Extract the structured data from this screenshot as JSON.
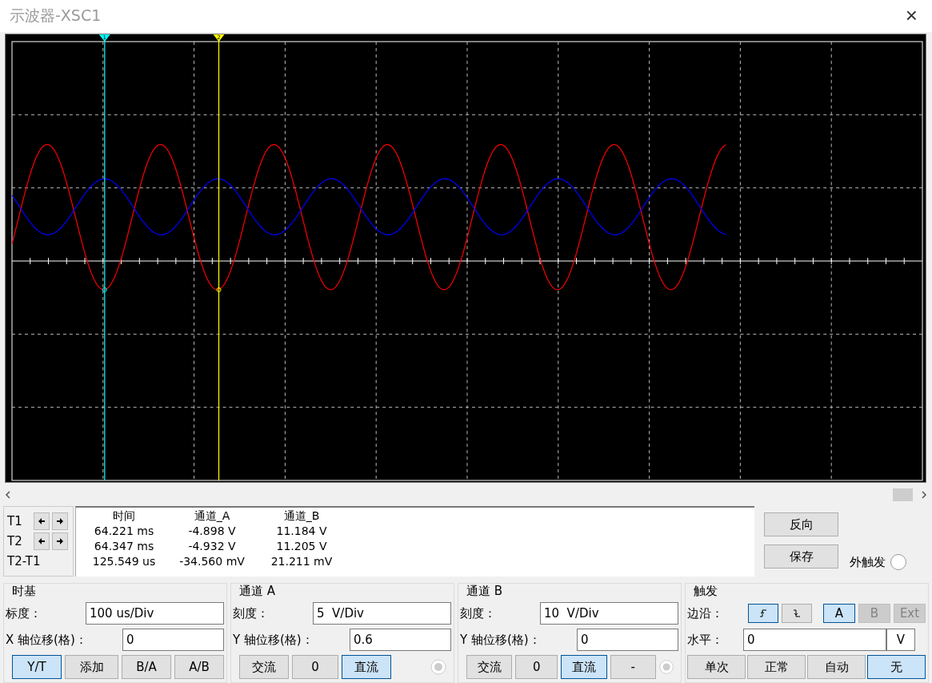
{
  "window": {
    "title": "示波器-XSC1",
    "close": "×"
  },
  "display": {
    "cursors": [
      {
        "label": "1",
        "color": "#00ffff"
      },
      {
        "label": "2",
        "color": "#ffff00"
      }
    ]
  },
  "cursor_controls": [
    {
      "label": "T1",
      "kind": "cursor"
    },
    {
      "label": "T2",
      "kind": "cursor"
    },
    {
      "label": "T2-T1",
      "kind": "difference"
    }
  ],
  "readout": {
    "columns": [
      "时间",
      "通道_A",
      "通道_B"
    ],
    "rows": [
      [
        "64.221 ms",
        "-4.898 V",
        "11.184 V"
      ],
      [
        "64.347 ms",
        "-4.932 V",
        "11.205 V"
      ],
      [
        "125.549 us",
        "-34.560 mV",
        "21.211 mV"
      ]
    ]
  },
  "buttons": [
    "反向",
    "保存"
  ],
  "external_trigger": {
    "label": "外触发",
    "selected": false
  },
  "timebase": {
    "title": "时基",
    "fields": [
      {
        "label": "标度：",
        "value": "100 us/Div"
      },
      {
        "label": "X 轴位移(格)：",
        "value": "0"
      }
    ],
    "modes": [
      {
        "label": "Y/T",
        "selected": true
      },
      {
        "label": "添加",
        "selected": false
      },
      {
        "label": "B/A",
        "selected": false
      },
      {
        "label": "A/B",
        "selected": false
      }
    ]
  },
  "channels": [
    {
      "title": "通道 A",
      "fields": [
        {
          "label": "刻度：",
          "value": "5  V/Div"
        },
        {
          "label": "Y 轴位移(格)：",
          "value": "0.6"
        }
      ],
      "coupling": [
        {
          "label": "交流",
          "selected": false
        },
        {
          "label": "0",
          "selected": false
        },
        {
          "label": "直流",
          "selected": true
        }
      ]
    },
    {
      "title": "通道 B",
      "fields": [
        {
          "label": "刻度：",
          "value": "10  V/Div"
        },
        {
          "label": "Y 轴位移(格)：",
          "value": "0"
        }
      ],
      "coupling": [
        {
          "label": "交流",
          "selected": false
        },
        {
          "label": "0",
          "selected": false
        },
        {
          "label": "直流",
          "selected": true
        },
        {
          "label": "-",
          "selected": false
        }
      ]
    }
  ],
  "trigger": {
    "title": "触发",
    "edge_label": "边沿：",
    "edges": [
      {
        "kind": "rising",
        "selected": true
      },
      {
        "kind": "falling",
        "selected": false
      }
    ],
    "sources": [
      {
        "label": "A",
        "selected": true,
        "disabled": false
      },
      {
        "label": "B",
        "selected": false,
        "disabled": true
      },
      {
        "label": "Ext",
        "selected": false,
        "disabled": true
      }
    ],
    "level_label": "水平：",
    "level_value": "0",
    "level_unit": "V",
    "modes": [
      {
        "label": "单次",
        "selected": false
      },
      {
        "label": "正常",
        "selected": false
      },
      {
        "label": "自动",
        "selected": false
      },
      {
        "label": "无",
        "selected": true
      }
    ]
  }
}
